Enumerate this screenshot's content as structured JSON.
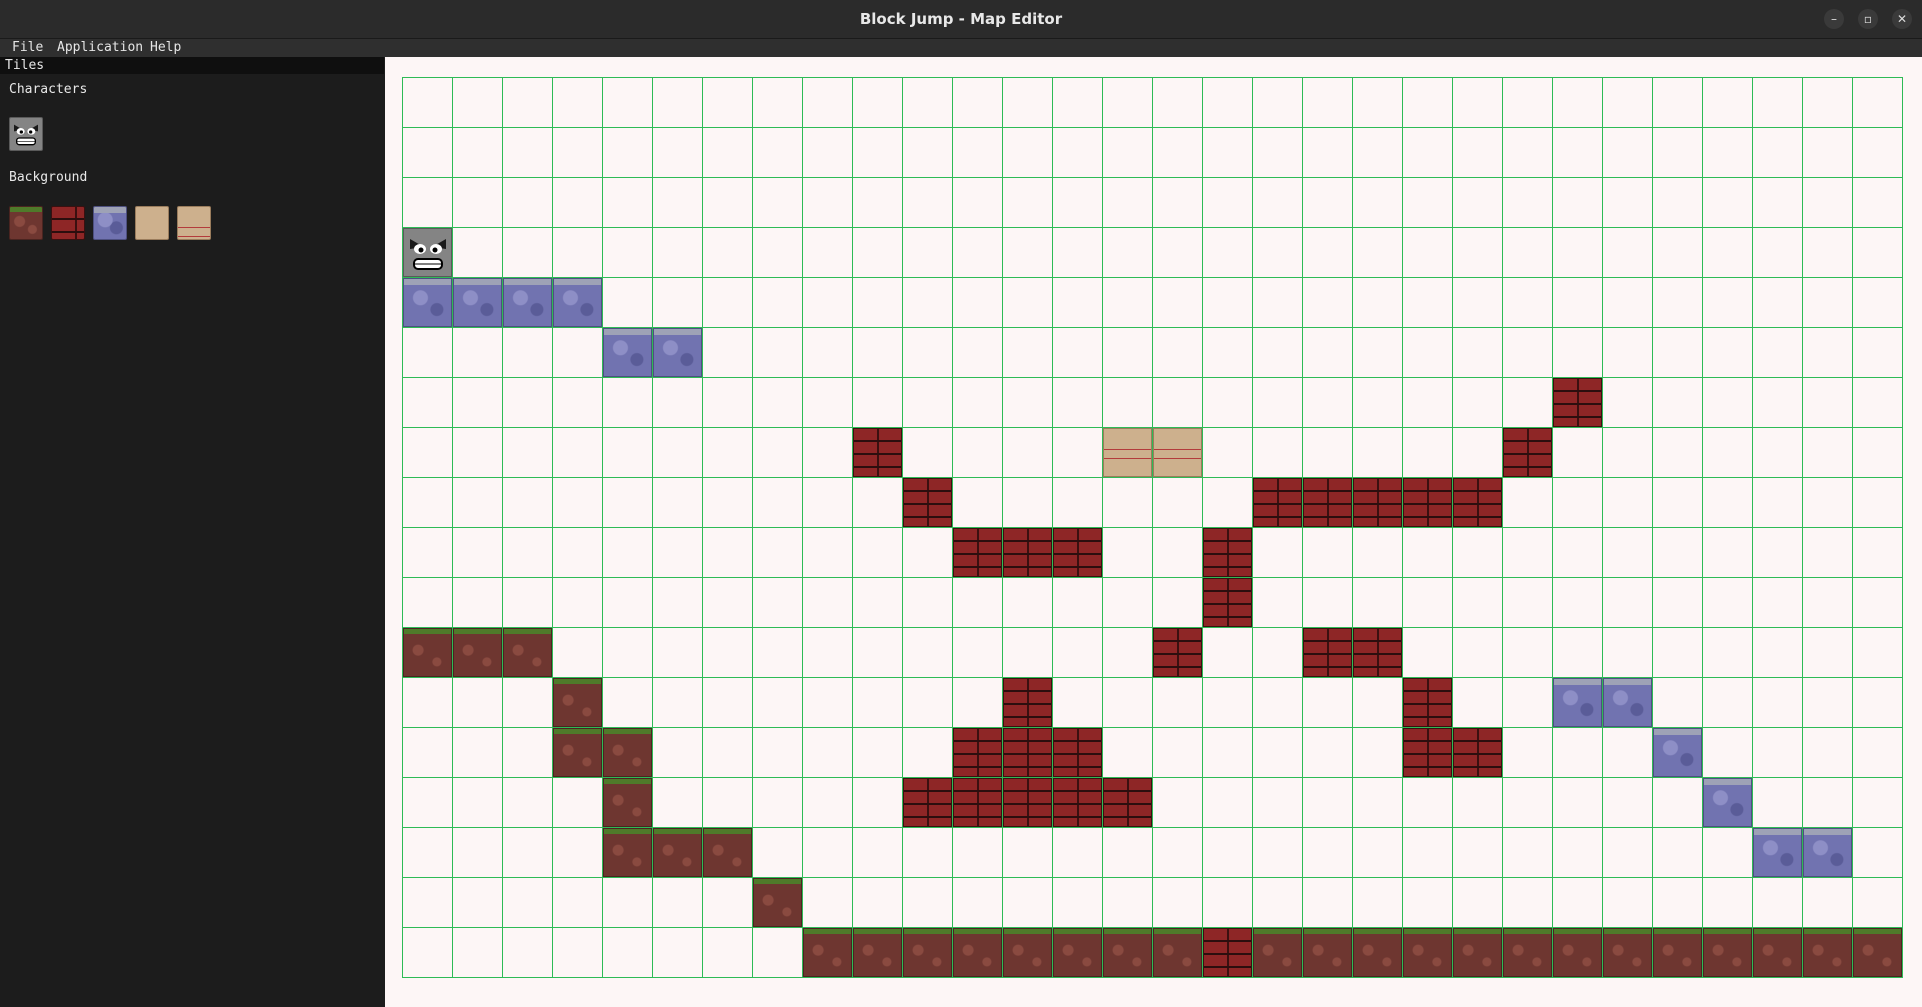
{
  "window": {
    "title": "Block Jump - Map Editor",
    "controls": [
      "minimize",
      "maximize",
      "close"
    ]
  },
  "menubar": {
    "items": [
      "File",
      "Application",
      "Help"
    ]
  },
  "sidebar": {
    "panel_title": "Tiles",
    "sections": [
      {
        "label": "Characters",
        "tiles": [
          "enemy-face"
        ]
      },
      {
        "label": "Background",
        "tiles": [
          "dirt",
          "brick",
          "stone",
          "crate-wood",
          "crate-label"
        ]
      }
    ]
  },
  "map": {
    "columns": 30,
    "rows": 18,
    "gridline_color": "#2dbb55",
    "background_color": "#fdf6f6",
    "tiles": [
      {
        "type": "character",
        "col": 0,
        "row": 3
      },
      {
        "type": "stone",
        "col": 0,
        "row": 4
      },
      {
        "type": "stone",
        "col": 1,
        "row": 4
      },
      {
        "type": "stone",
        "col": 2,
        "row": 4
      },
      {
        "type": "stone",
        "col": 3,
        "row": 4
      },
      {
        "type": "stone",
        "col": 4,
        "row": 5
      },
      {
        "type": "stone",
        "col": 5,
        "row": 5
      },
      {
        "type": "brick",
        "col": 23,
        "row": 6
      },
      {
        "type": "brick",
        "col": 9,
        "row": 7
      },
      {
        "type": "crate",
        "col": 14,
        "row": 7
      },
      {
        "type": "crate",
        "col": 15,
        "row": 7
      },
      {
        "type": "brick",
        "col": 22,
        "row": 7
      },
      {
        "type": "brick",
        "col": 10,
        "row": 8
      },
      {
        "type": "brick",
        "col": 17,
        "row": 8
      },
      {
        "type": "brick",
        "col": 18,
        "row": 8
      },
      {
        "type": "brick",
        "col": 19,
        "row": 8
      },
      {
        "type": "brick",
        "col": 20,
        "row": 8
      },
      {
        "type": "brick",
        "col": 21,
        "row": 8
      },
      {
        "type": "brick",
        "col": 11,
        "row": 9
      },
      {
        "type": "brick",
        "col": 12,
        "row": 9
      },
      {
        "type": "brick",
        "col": 13,
        "row": 9
      },
      {
        "type": "brick",
        "col": 16,
        "row": 9
      },
      {
        "type": "brick",
        "col": 16,
        "row": 10
      },
      {
        "type": "dirt",
        "col": 0,
        "row": 11
      },
      {
        "type": "dirt",
        "col": 1,
        "row": 11
      },
      {
        "type": "dirt",
        "col": 2,
        "row": 11
      },
      {
        "type": "brick",
        "col": 15,
        "row": 11
      },
      {
        "type": "brick",
        "col": 18,
        "row": 11
      },
      {
        "type": "brick",
        "col": 19,
        "row": 11
      },
      {
        "type": "dirt",
        "col": 3,
        "row": 12
      },
      {
        "type": "brick",
        "col": 12,
        "row": 12
      },
      {
        "type": "brick",
        "col": 20,
        "row": 12
      },
      {
        "type": "stone",
        "col": 23,
        "row": 12
      },
      {
        "type": "stone",
        "col": 24,
        "row": 12
      },
      {
        "type": "dirt",
        "col": 3,
        "row": 13
      },
      {
        "type": "dirt",
        "col": 4,
        "row": 13
      },
      {
        "type": "brick",
        "col": 11,
        "row": 13
      },
      {
        "type": "brick",
        "col": 12,
        "row": 13
      },
      {
        "type": "brick",
        "col": 13,
        "row": 13
      },
      {
        "type": "brick",
        "col": 20,
        "row": 13
      },
      {
        "type": "brick",
        "col": 21,
        "row": 13
      },
      {
        "type": "stone",
        "col": 25,
        "row": 13
      },
      {
        "type": "dirt",
        "col": 4,
        "row": 14
      },
      {
        "type": "brick",
        "col": 10,
        "row": 14
      },
      {
        "type": "brick",
        "col": 11,
        "row": 14
      },
      {
        "type": "brick",
        "col": 12,
        "row": 14
      },
      {
        "type": "brick",
        "col": 13,
        "row": 14
      },
      {
        "type": "brick",
        "col": 14,
        "row": 14
      },
      {
        "type": "stone",
        "col": 26,
        "row": 14
      },
      {
        "type": "dirt",
        "col": 4,
        "row": 15
      },
      {
        "type": "dirt",
        "col": 5,
        "row": 15
      },
      {
        "type": "dirt",
        "col": 6,
        "row": 15
      },
      {
        "type": "stone",
        "col": 27,
        "row": 15
      },
      {
        "type": "stone",
        "col": 28,
        "row": 15
      },
      {
        "type": "dirt",
        "col": 7,
        "row": 16
      },
      {
        "type": "dirt",
        "col": 8,
        "row": 17
      },
      {
        "type": "dirt",
        "col": 9,
        "row": 17
      },
      {
        "type": "dirt",
        "col": 10,
        "row": 17
      },
      {
        "type": "dirt",
        "col": 11,
        "row": 17
      },
      {
        "type": "dirt",
        "col": 12,
        "row": 17
      },
      {
        "type": "dirt",
        "col": 13,
        "row": 17
      },
      {
        "type": "dirt",
        "col": 14,
        "row": 17
      },
      {
        "type": "dirt",
        "col": 15,
        "row": 17
      },
      {
        "type": "brick",
        "col": 16,
        "row": 17
      },
      {
        "type": "dirt",
        "col": 17,
        "row": 17
      },
      {
        "type": "dirt",
        "col": 18,
        "row": 17
      },
      {
        "type": "dirt",
        "col": 19,
        "row": 17
      },
      {
        "type": "dirt",
        "col": 20,
        "row": 17
      },
      {
        "type": "dirt",
        "col": 21,
        "row": 17
      },
      {
        "type": "dirt",
        "col": 22,
        "row": 17
      },
      {
        "type": "dirt",
        "col": 23,
        "row": 17
      },
      {
        "type": "dirt",
        "col": 24,
        "row": 17
      },
      {
        "type": "dirt",
        "col": 25,
        "row": 17
      },
      {
        "type": "dirt",
        "col": 26,
        "row": 17
      },
      {
        "type": "dirt",
        "col": 27,
        "row": 17
      },
      {
        "type": "dirt",
        "col": 28,
        "row": 17
      },
      {
        "type": "dirt",
        "col": 29,
        "row": 17
      }
    ]
  }
}
